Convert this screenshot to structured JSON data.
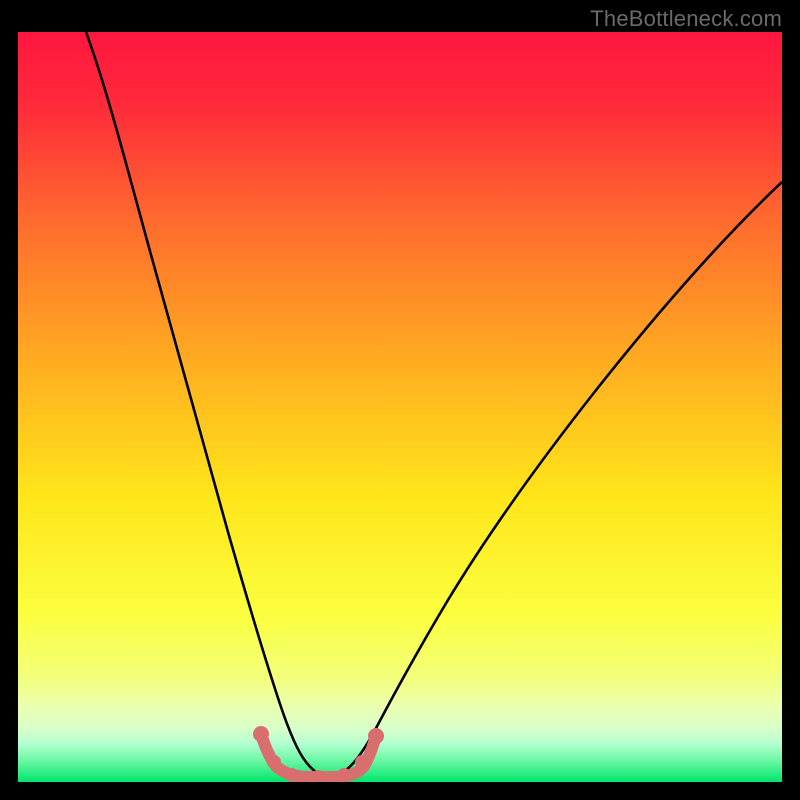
{
  "watermark": "TheBottleneck.com",
  "colors": {
    "black": "#000000",
    "gradient_top": "#ff1a3c",
    "gradient_mid1": "#ff7a2a",
    "gradient_mid2": "#ffe020",
    "gradient_mid3": "#f7ff55",
    "gradient_mid4": "#e0ffb0",
    "gradient_bottom": "#00e66a",
    "curve": "#000000",
    "trough_stroke": "#dc6e6e",
    "trough_fill": "#d76a6a"
  },
  "chart_data": {
    "type": "line",
    "title": "",
    "xlabel": "",
    "ylabel": "",
    "xlim": [
      0,
      100
    ],
    "ylim": [
      0,
      100
    ],
    "grid": false,
    "legend": false,
    "annotations": [
      {
        "text": "TheBottleneck.com",
        "pos": "top-right"
      }
    ],
    "series": [
      {
        "name": "bottleneck-curve",
        "note": "Values read as percentage height of the black curve from bottom of the plot. Left arm falls steeply, flat trough at ~0 between x≈32-42, right arm rises.",
        "x": [
          0,
          2,
          4,
          6,
          8,
          10,
          12,
          14,
          16,
          18,
          20,
          22,
          24,
          26,
          28,
          30,
          32,
          34,
          36,
          38,
          40,
          42,
          44,
          46,
          48,
          50,
          54,
          58,
          62,
          66,
          70,
          74,
          78,
          82,
          86,
          90,
          94,
          98,
          100
        ],
        "y": [
          100,
          98,
          95,
          91,
          87,
          82,
          77,
          72,
          66,
          60,
          54,
          47,
          40,
          33,
          26,
          19,
          12,
          5,
          1,
          0,
          0,
          0,
          1,
          2,
          5,
          9,
          16,
          22,
          28,
          33,
          38,
          43,
          47,
          51,
          55,
          59,
          62,
          65,
          67
        ]
      },
      {
        "name": "optimal-trough-highlight",
        "note": "Pink/coral U-shaped highlight with dots marking the flat zero-bottleneck region.",
        "x": [
          30,
          32,
          34,
          36,
          38,
          40,
          42,
          44
        ],
        "y": [
          6,
          2,
          0.5,
          0,
          0,
          0.5,
          2,
          6
        ]
      }
    ]
  }
}
